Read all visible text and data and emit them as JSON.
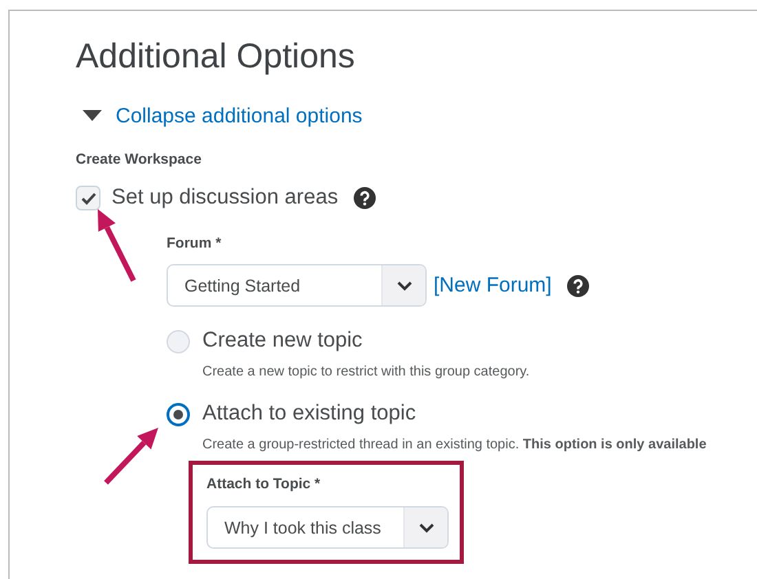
{
  "title": "Additional Options",
  "collapse": {
    "label": "Collapse additional options",
    "expanded": true
  },
  "section_label": "Create Workspace",
  "discussion": {
    "label": "Set up discussion areas",
    "checked": true
  },
  "forum": {
    "label": "Forum *",
    "value": "Getting Started",
    "new_link": "[New Forum]"
  },
  "topic_options": [
    {
      "label": "Create new topic",
      "description": "Create a new topic to restrict with this group category.",
      "selected": false
    },
    {
      "label": "Attach to existing topic",
      "description": "Create a group-restricted thread in an existing topic. **This option is only available**",
      "selected": true
    }
  ],
  "attach": {
    "label": "Attach to Topic *",
    "value": "Why I took this class",
    "highlighted": true
  }
}
